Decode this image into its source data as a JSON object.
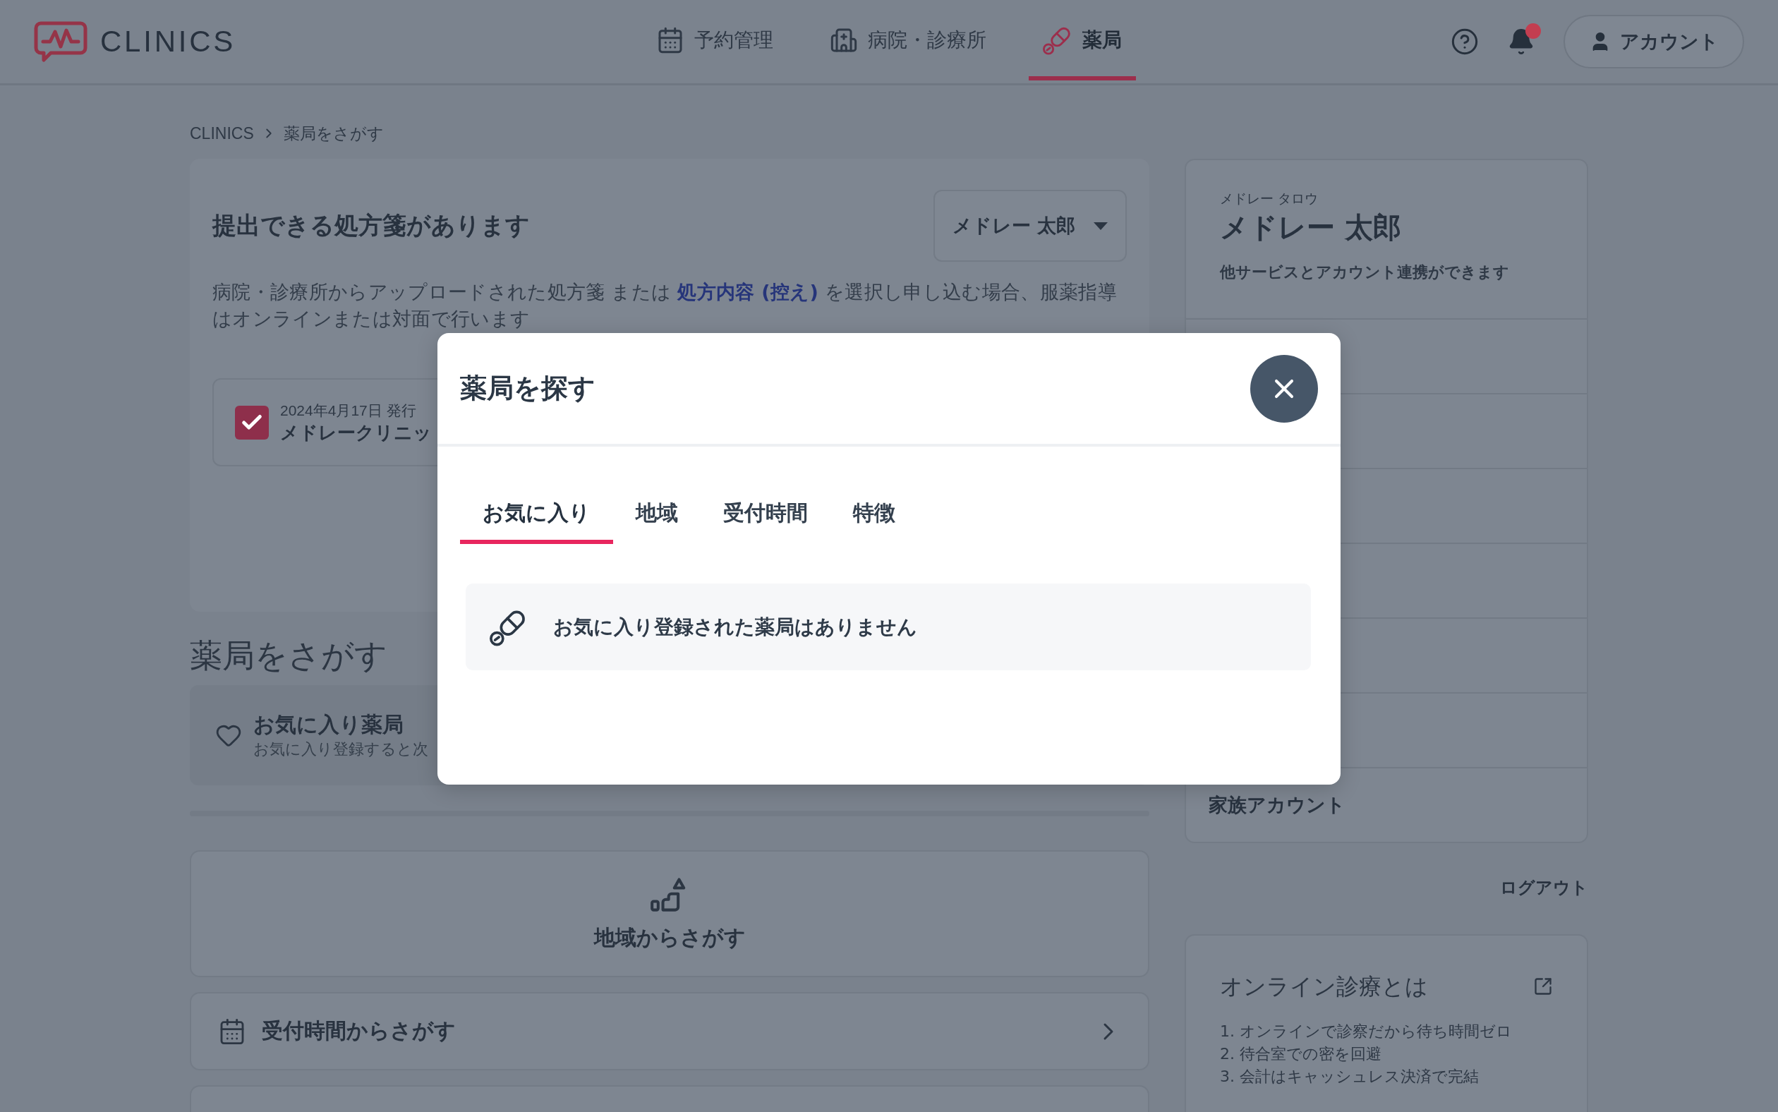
{
  "header": {
    "logo": "CLINICS",
    "nav": [
      {
        "label": "予約管理",
        "selected": false
      },
      {
        "label": "病院・診療所",
        "selected": false
      },
      {
        "label": "薬局",
        "selected": true
      }
    ],
    "notifications": {
      "unread": true
    },
    "account_button": "アカウント"
  },
  "breadcrumb": [
    "CLINICS",
    "薬局をさがす"
  ],
  "prescription_card": {
    "title": "提出できる処方箋があります",
    "patient_select": {
      "value": "メドレー 太郎"
    },
    "description": {
      "before": "病院・診療所からアップロードされた処方箋 または ",
      "link": "処方内容 (控え)",
      "after": " を選択し申し込む場合、服薬指導はオンラインまたは対面で行います"
    },
    "prescription": {
      "checked": true,
      "date": "2024年4月17日 発行",
      "clinic": "メドレークリニッ"
    }
  },
  "search_section": {
    "heading": "薬局をさがす",
    "favorites": {
      "title": "お気に入り薬局",
      "subtitle": "お気に入り登録すると次"
    },
    "options": [
      {
        "kind": "tile",
        "label": "地域からさがす"
      },
      {
        "kind": "row",
        "label": "受付時間からさがす"
      }
    ]
  },
  "sidebar": {
    "profile": {
      "kana": "メドレー タロウ",
      "name": "メドレー 太郎",
      "note": "他サービスとアカウント連携ができます"
    },
    "menu": [
      "家族アカウント"
    ],
    "logout": "ログアウト",
    "info_card": {
      "title": "オンライン診療とは",
      "items": [
        "1. オンラインで診察だから待ち時間ゼロ",
        "2. 待合室での密を回避",
        "3. 会計はキャッシュレス決済で完結"
      ]
    }
  },
  "modal": {
    "title": "薬局を探す",
    "tabs": [
      {
        "label": "お気に入り",
        "selected": true
      },
      {
        "label": "地域",
        "selected": false
      },
      {
        "label": "受付時間",
        "selected": false
      },
      {
        "label": "特徴",
        "selected": false
      }
    ],
    "empty_message": "お気に入り登録された薬局はありません"
  }
}
